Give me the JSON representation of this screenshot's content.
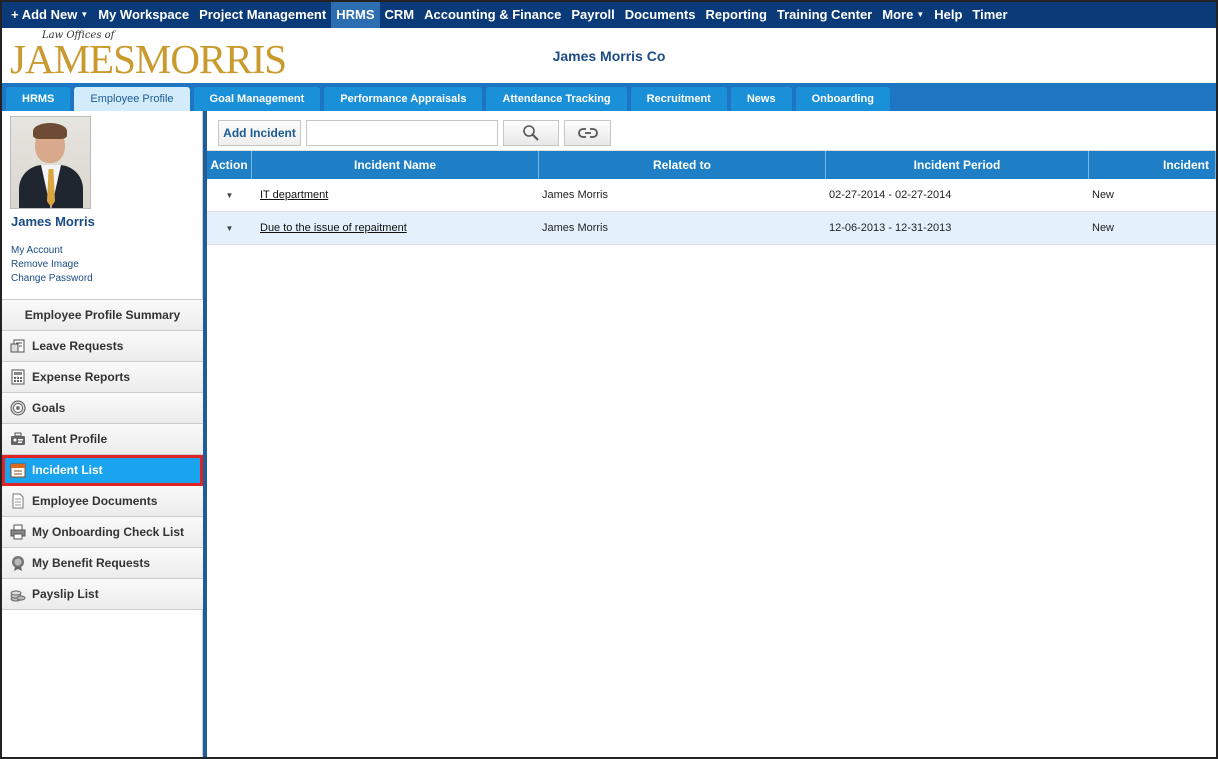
{
  "topnav": {
    "items": [
      {
        "label": "+ Add New",
        "caret": "▼"
      },
      {
        "label": "My Workspace"
      },
      {
        "label": "Project Management"
      },
      {
        "label": "HRMS"
      },
      {
        "label": "CRM"
      },
      {
        "label": "Accounting & Finance"
      },
      {
        "label": "Payroll"
      },
      {
        "label": "Documents"
      },
      {
        "label": "Reporting"
      },
      {
        "label": "Training Center"
      },
      {
        "label": "More",
        "caret": "▼"
      },
      {
        "label": "Help"
      },
      {
        "label": "Timer"
      }
    ]
  },
  "header": {
    "logo_small": "Law Offices of",
    "logo_big": "JAMESMORRIS",
    "company": "James Morris Co"
  },
  "tabs": [
    {
      "label": "HRMS"
    },
    {
      "label": "Employee Profile"
    },
    {
      "label": "Goal Management"
    },
    {
      "label": "Performance Appraisals"
    },
    {
      "label": "Attendance Tracking"
    },
    {
      "label": "Recruitment"
    },
    {
      "label": "News"
    },
    {
      "label": "Onboarding"
    }
  ],
  "sidebar": {
    "user_name": "James Morris",
    "links": [
      "My Account",
      "Remove Image",
      "Change Password"
    ],
    "menu": [
      {
        "label": "Employee Profile Summary",
        "icon": "summary"
      },
      {
        "label": "Leave Requests",
        "icon": "leave-icon"
      },
      {
        "label": "Expense Reports",
        "icon": "expense-icon"
      },
      {
        "label": "Goals",
        "icon": "target-icon"
      },
      {
        "label": "Talent Profile",
        "icon": "talent-icon"
      },
      {
        "label": "Incident List",
        "icon": "calendar-icon"
      },
      {
        "label": "Employee Documents",
        "icon": "document-icon"
      },
      {
        "label": "My Onboarding Check List",
        "icon": "printer-icon"
      },
      {
        "label": "My Benefit Requests",
        "icon": "badge-icon"
      },
      {
        "label": "Payslip List",
        "icon": "coins-icon"
      }
    ]
  },
  "toolbar": {
    "add_label": "Add Incident",
    "search_placeholder": "",
    "search_value": ""
  },
  "grid": {
    "columns": [
      "Action",
      "Incident Name",
      "Related to",
      "Incident Period",
      "Incident"
    ],
    "rows": [
      {
        "name": "IT department",
        "related": "James Morris",
        "period": "02-27-2014 - 02-27-2014",
        "status": "New"
      },
      {
        "name": "Due to the issue of repaitment",
        "related": "James Morris",
        "period": "12-06-2013 - 12-31-2013",
        "status": "New"
      }
    ]
  },
  "colors": {
    "topnav": "#0b3a79",
    "tabbar": "#1e76c2",
    "active_menu": "#1aa3ee",
    "highlight_border": "#e02424",
    "logo_gold": "#c99a2e"
  }
}
